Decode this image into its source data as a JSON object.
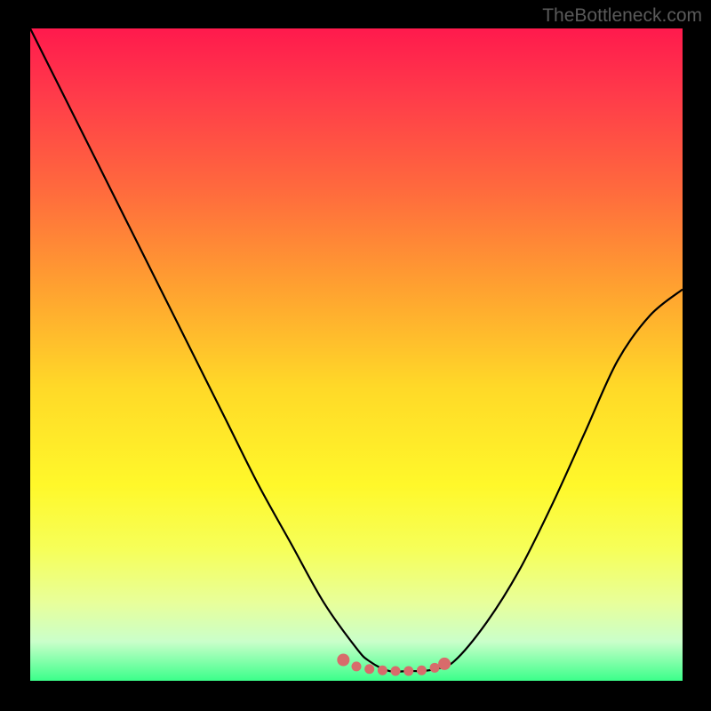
{
  "watermark": "TheBottleneck.com",
  "chart_data": {
    "type": "line",
    "title": "",
    "xlabel": "",
    "ylabel": "",
    "xlim": [
      0,
      100
    ],
    "ylim": [
      0,
      100
    ],
    "series": [
      {
        "name": "curve",
        "x": [
          0,
          5,
          10,
          15,
          20,
          25,
          30,
          35,
          40,
          45,
          50,
          52,
          55,
          58,
          60,
          62,
          65,
          70,
          75,
          80,
          85,
          90,
          95,
          100
        ],
        "y": [
          100,
          90,
          80,
          70,
          60,
          50,
          40,
          30,
          21,
          12,
          5,
          3,
          1.5,
          1.5,
          1.5,
          1.8,
          3,
          9,
          17,
          27,
          38,
          49,
          56,
          60
        ]
      }
    ],
    "markers": {
      "name": "highlight-dots",
      "x": [
        48,
        50,
        52,
        54,
        56,
        58,
        60,
        62,
        63.5
      ],
      "y": [
        3.2,
        2.2,
        1.8,
        1.6,
        1.5,
        1.5,
        1.6,
        2.0,
        2.6
      ]
    },
    "gradient_stops": [
      {
        "pos": 0.0,
        "color": "#ff1a4d"
      },
      {
        "pos": 0.25,
        "color": "#ff6b3d"
      },
      {
        "pos": 0.55,
        "color": "#ffd928"
      },
      {
        "pos": 0.8,
        "color": "#f6ff5a"
      },
      {
        "pos": 1.0,
        "color": "#3bff8a"
      }
    ]
  }
}
